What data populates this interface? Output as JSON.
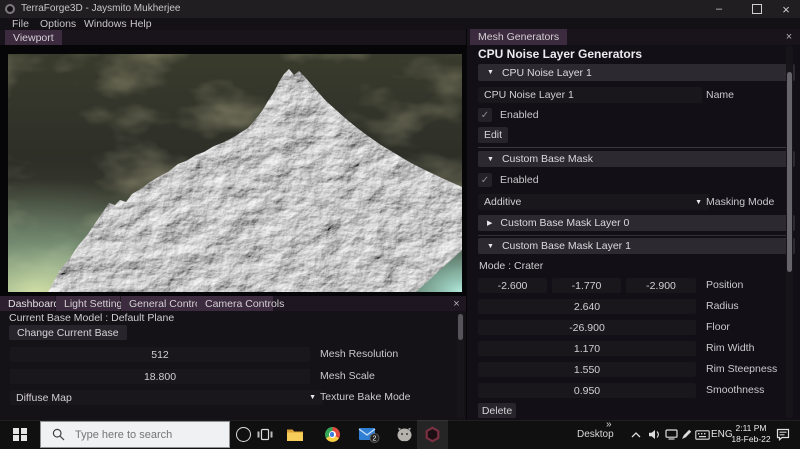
{
  "window": {
    "title": "TerraForge3D - Jaysmito Mukherjee"
  },
  "menu": {
    "items": [
      "File",
      "Options",
      "Windows",
      "Help"
    ]
  },
  "viewport": {
    "tab_label": "Viewport"
  },
  "glyphs": {
    "expanded": "▼",
    "collapsed": "▶",
    "combo_arrow": "▼",
    "check": "✓",
    "close": "×",
    "minimize": "–",
    "overflow": "»"
  },
  "dashboard_panel": {
    "tabs": [
      "Dashboard",
      "Light Setting",
      "General Controls",
      "Camera Controls"
    ],
    "current_base_model": "Current Base Model : Default Plane",
    "change_base_button": "Change Current Base",
    "mesh_resolution": {
      "value": "512",
      "label": "Mesh Resolution"
    },
    "mesh_scale": {
      "value": "18.800",
      "label": "Mesh Scale"
    },
    "texture_bake_mode": {
      "value": "Diffuse Map",
      "label": "Texture Bake Mode"
    }
  },
  "mesh_generators_panel": {
    "tab_label": "Mesh Generators",
    "title": "CPU Noise Layer Generators",
    "cpu_noise_layer_1": {
      "header": "CPU Noise Layer 1",
      "name_value": "CPU Noise Layer 1",
      "name_label": "Name",
      "enabled_label": "Enabled",
      "edit_button": "Edit"
    },
    "custom_base_mask": {
      "header": "Custom Base Mask",
      "enabled_label": "Enabled",
      "masking_mode_value": "Additive",
      "masking_mode_label": "Masking Mode"
    },
    "mask_layer_0": {
      "header": "Custom Base Mask Layer 0"
    },
    "mask_layer_1": {
      "header": "Custom Base Mask Layer 1",
      "mode_text": "Mode : Crater",
      "position": {
        "x": "-2.600",
        "y": "-1.770",
        "z": "-2.900",
        "label": "Position"
      },
      "radius": {
        "value": "2.640",
        "label": "Radius"
      },
      "floor": {
        "value": "-26.900",
        "label": "Floor"
      },
      "rim_width": {
        "value": "1.170",
        "label": "Rim Width"
      },
      "rim_steepness": {
        "value": "1.550",
        "label": "Rim Steepness"
      },
      "smoothness": {
        "value": "0.950",
        "label": "Smoothness"
      },
      "delete_button": "Delete"
    }
  },
  "taskbar": {
    "search_placeholder": "Type here to search",
    "mail_badge": "2",
    "tray": {
      "desktop_label": "Desktop",
      "language": "ENG",
      "time": "2:11 PM",
      "date": "18-Feb-22"
    }
  },
  "colors": {
    "accent_purple": "#3c2a3e",
    "panel_bg": "#121016",
    "header_bg": "#2c2a30",
    "input_bg": "#19171c",
    "button_bg": "#27252b"
  }
}
